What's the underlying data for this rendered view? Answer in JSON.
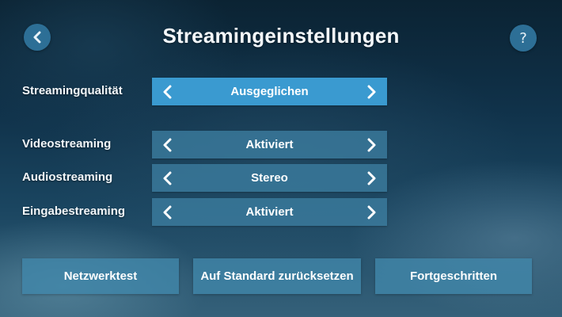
{
  "header": {
    "title": "Streamingeinstellungen",
    "back_icon": "chevron-left-icon",
    "help_label": "?"
  },
  "settings": [
    {
      "label": "Streamingqualität",
      "value": "Ausgeglichen",
      "selected": true
    },
    {
      "label": "Videostreaming",
      "value": "Aktiviert",
      "selected": false
    },
    {
      "label": "Audiostreaming",
      "value": "Stereo",
      "selected": false
    },
    {
      "label": "Eingabestreaming",
      "value": "Aktiviert",
      "selected": false
    }
  ],
  "buttons": {
    "network_test": "Netzwerktest",
    "reset": "Auf Standard zurücksetzen",
    "advanced": "Fortgeschritten"
  },
  "colors": {
    "accent": "#3a9ad0",
    "selector": "#3c7da0",
    "circle_button": "#2d6f96"
  }
}
